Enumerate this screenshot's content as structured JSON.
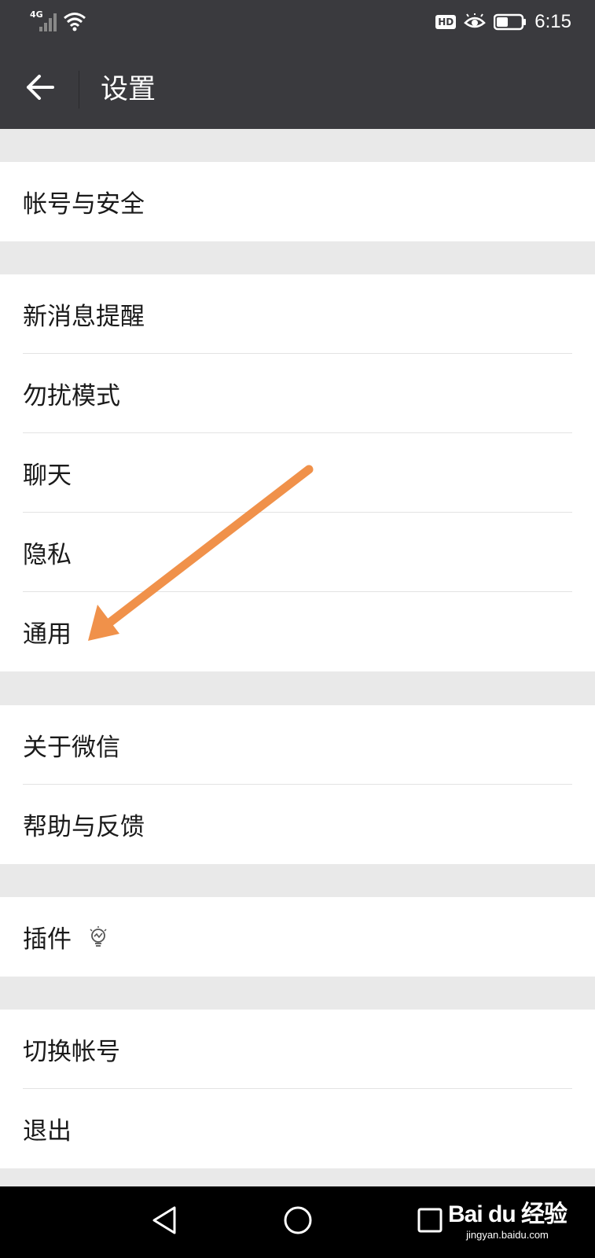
{
  "status_bar": {
    "network": "4G",
    "hd_badge": "HD",
    "time": "6:15",
    "icons": [
      "signal-icon",
      "wifi-icon",
      "hd-icon",
      "eye-icon",
      "battery-icon"
    ]
  },
  "app_bar": {
    "title": "设置",
    "back_icon": "back-arrow-icon"
  },
  "groups": [
    {
      "items": [
        "帐号与安全"
      ]
    },
    {
      "items": [
        "新消息提醒",
        "勿扰模式",
        "聊天",
        "隐私",
        "通用"
      ]
    },
    {
      "items": [
        "关于微信",
        "帮助与反馈"
      ]
    },
    {
      "items": [
        "插件"
      ]
    },
    {
      "items": [
        "切换帐号",
        "退出"
      ]
    }
  ],
  "annotation": {
    "arrow_color": "#f0914a",
    "points_to": "通用"
  },
  "nav_bar": {
    "icons": [
      "back-triangle-icon",
      "home-circle-icon",
      "recents-square-icon"
    ]
  },
  "watermark": {
    "logo": "Bai du 经验",
    "url": "jingyan.baidu.com"
  },
  "colors": {
    "header_bg": "#3a3a3e",
    "page_bg": "#e9e9e9",
    "row_bg": "#ffffff",
    "nav_bg": "#000000"
  }
}
